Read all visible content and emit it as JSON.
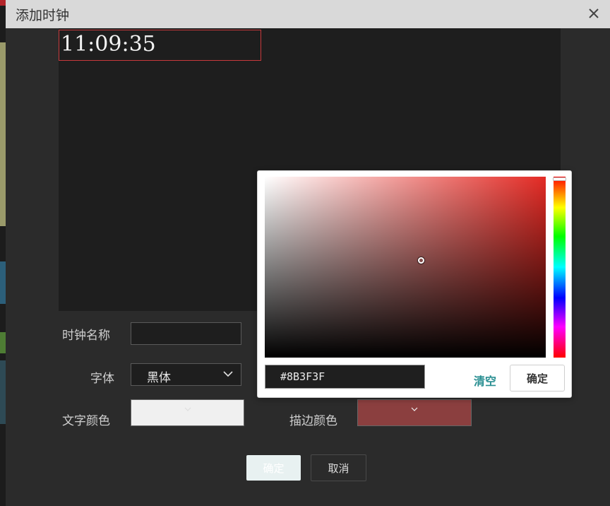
{
  "dialog": {
    "title": "添加时钟",
    "close_icon": "close-icon"
  },
  "preview": {
    "clock_text": "11:09:35"
  },
  "form": {
    "name_label": "时钟名称",
    "name_value": "",
    "font_label": "字体",
    "font_value": "黑体",
    "text_color_label": "文字颜色",
    "text_color": "#f0f0f0",
    "stroke_color_label": "描边颜色",
    "stroke_color": "#8B3F3F"
  },
  "buttons": {
    "ok": "确定",
    "cancel": "取消"
  },
  "color_picker": {
    "hex_value": "#8B3F3F",
    "clear_label": "清空",
    "ok_label": "确定",
    "current_color": "#8B3F3F"
  },
  "colors": {
    "accent": "#2a8f92",
    "clock_box_border": "#c8393c"
  }
}
